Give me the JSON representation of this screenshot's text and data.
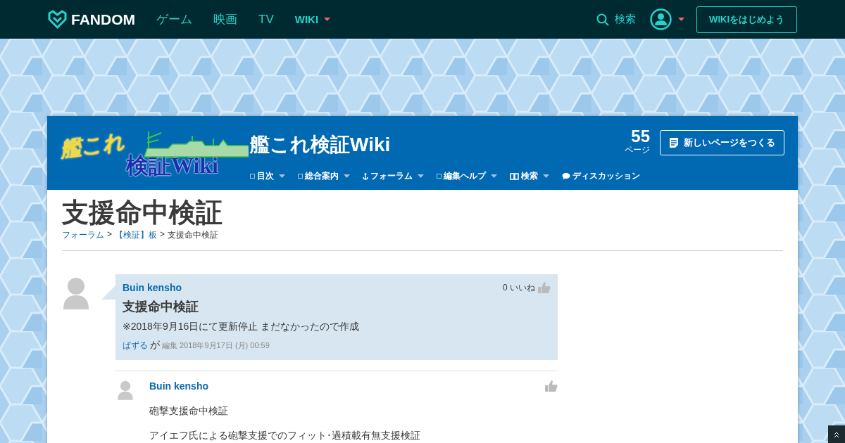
{
  "topbar": {
    "brand": "FANDOM",
    "links": [
      {
        "label": "ゲーム",
        "kind": "plain"
      },
      {
        "label": "映画",
        "kind": "plain"
      },
      {
        "label": "TV",
        "kind": "plain"
      },
      {
        "label": "WIKI",
        "kind": "dropdown"
      }
    ],
    "search": "検索",
    "start_button": "WIKIをはじめよう"
  },
  "wiki": {
    "logo_lines": [
      "艦これ",
      "検証Wiki"
    ],
    "name": "艦これ検証Wiki",
    "page_count": "55",
    "page_unit": "ページ",
    "new_page_button": "新しいページをつくる",
    "nav": [
      {
        "label": "目次",
        "kind": "box"
      },
      {
        "label": "総合案内",
        "kind": "box"
      },
      {
        "label": "フォーラム",
        "kind": "anchor"
      },
      {
        "label": "編集ヘルプ",
        "kind": "box"
      },
      {
        "label": "検索",
        "kind": "book"
      },
      {
        "label": "ディスカッション",
        "kind": "bubble"
      }
    ]
  },
  "page": {
    "title": "支援命中検証",
    "separator": ">",
    "breadcrumb": [
      {
        "label": "フォーラム",
        "link": true
      },
      {
        "label": "【検証】板",
        "link": true
      },
      {
        "label": "支援命中検証",
        "link": false
      }
    ]
  },
  "thread": {
    "author": "Buin kensho",
    "likes": "0 いいね",
    "title": "支援命中検証",
    "body": "※2018年9月16日にて更新停止 まだなかったので作成",
    "editor": "ぱずる",
    "edit_word": "が",
    "edit_label": "編集",
    "edit_time": "2018年9月17日 (月) 00:59"
  },
  "replies": [
    {
      "author": "Buin kensho",
      "paragraphs": [
        "砲撃支援命中検証",
        "アイエフ氏による砲撃支援でのフィット･過積載有無支援検証"
      ]
    }
  ]
}
